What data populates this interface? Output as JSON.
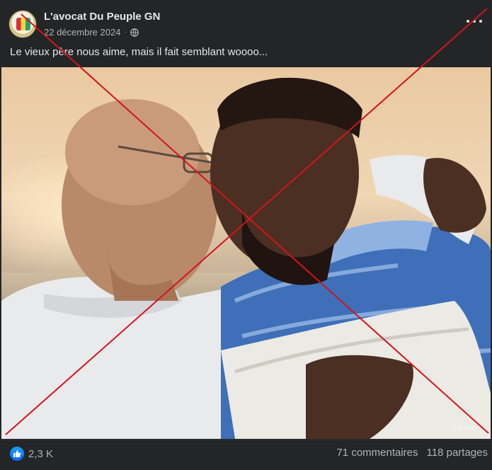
{
  "post": {
    "author": "L'avocat Du Peuple GN",
    "date": "22 décembre 2024",
    "separator": "·",
    "caption": "Le vieux père nous aime, mais il fait semblant woooo...",
    "image_watermark": "GROK"
  },
  "footer": {
    "reaction_count": "2,3 K",
    "comments": "71 commentaires",
    "shares": "118 partages"
  },
  "colors": {
    "background": "#242526",
    "text_primary": "#e4e6eb",
    "text_secondary": "#b0b3b8",
    "like_blue": "#0866ff",
    "cross_red": "#d4141c"
  },
  "icons": [
    "globe-icon",
    "more-icon",
    "like-icon"
  ]
}
